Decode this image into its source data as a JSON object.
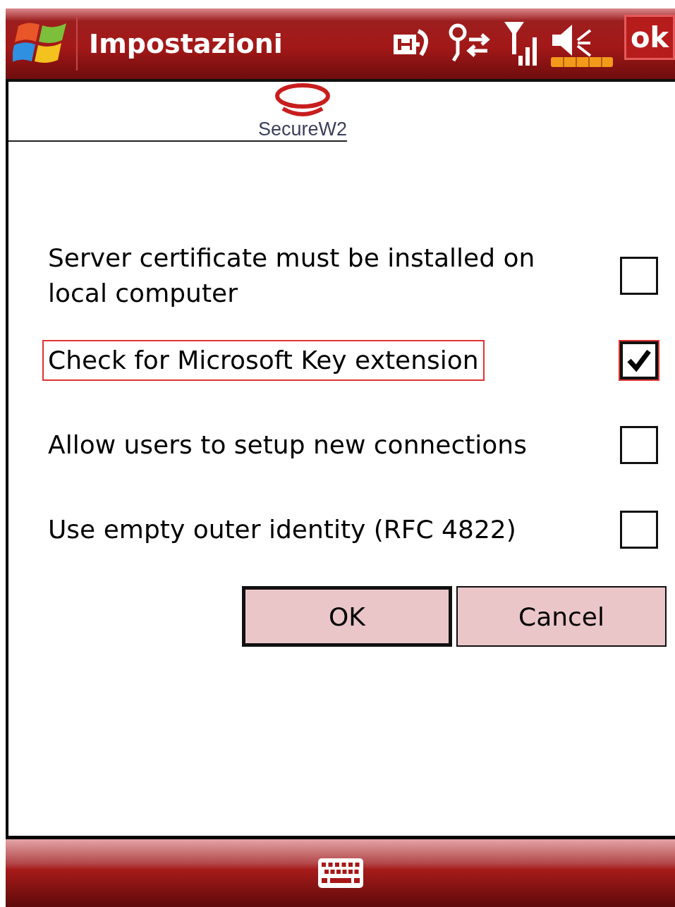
{
  "title_bar": {
    "title": "Impostazioni",
    "ok": "ok"
  },
  "logo": {
    "name": "SecureW2"
  },
  "options": [
    {
      "label": "Server certificate must be installed on local computer",
      "checked": false,
      "focused": false
    },
    {
      "label": "Check for Microsoft Key extension",
      "checked": true,
      "focused": true
    },
    {
      "label": "Allow users to setup new connections",
      "checked": false,
      "focused": false
    },
    {
      "label": "Use empty outer identity (RFC 4822)",
      "checked": false,
      "focused": false
    }
  ],
  "buttons": [
    {
      "label": "OK",
      "default": true
    },
    {
      "label": "Cancel",
      "default": false
    }
  ]
}
